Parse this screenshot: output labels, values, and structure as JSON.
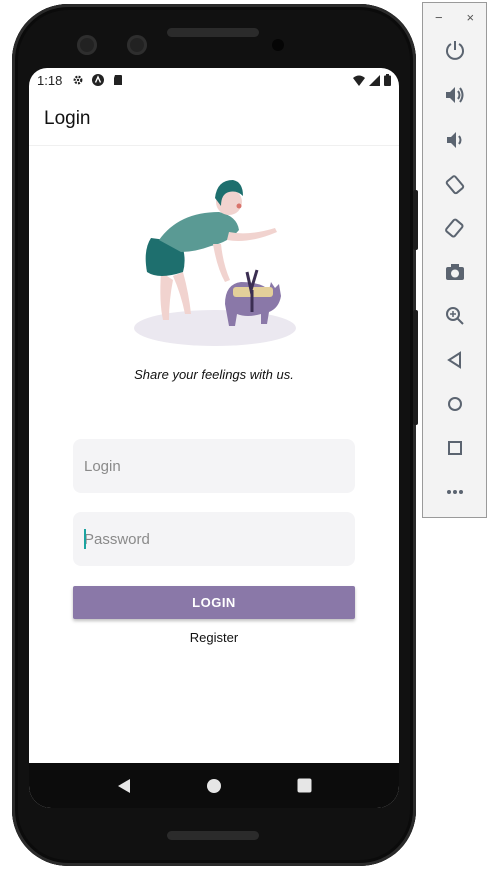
{
  "status_bar": {
    "time": "1:18"
  },
  "app_bar": {
    "title": "Login"
  },
  "hero": {
    "tagline": "Share your feelings with us."
  },
  "form": {
    "login_placeholder": "Login",
    "password_placeholder": "Password",
    "login_button_label": "LOGIN",
    "register_link_label": "Register"
  },
  "emulator_toolbar": {
    "minimize_label": "−",
    "close_label": "×",
    "buttons": [
      "power-icon",
      "volume-up-icon",
      "volume-down-icon",
      "rotate-left-icon",
      "rotate-right-icon",
      "camera-icon",
      "zoom-icon",
      "back-icon",
      "home-icon",
      "overview-icon",
      "more-icon"
    ]
  },
  "colors": {
    "accent": "#8a78a8",
    "field_bg": "#f4f4f6",
    "caret": "#1aa3a0"
  }
}
